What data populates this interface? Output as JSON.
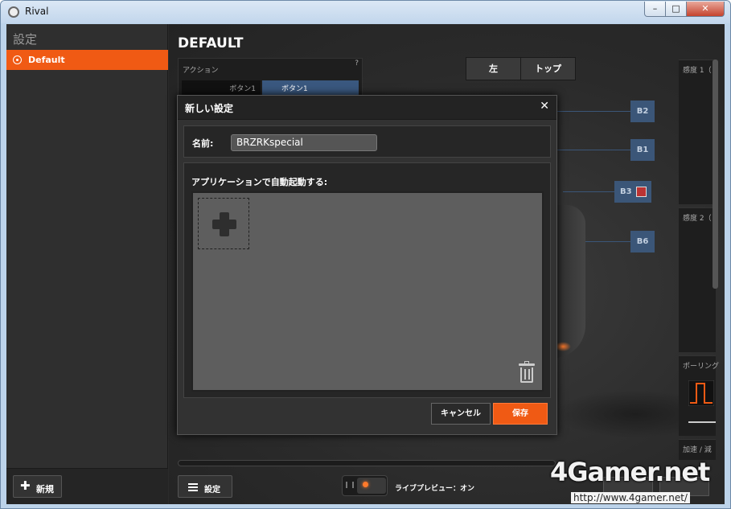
{
  "window": {
    "title": "Rival",
    "min": "–",
    "max": "□",
    "close": "✕"
  },
  "sidebar": {
    "heading": "設定",
    "items": [
      {
        "label": "Default",
        "selected": true
      }
    ],
    "new_button": "新規"
  },
  "main": {
    "heading": "DEFAULT",
    "action_panel": {
      "title": "アクション",
      "help": "?",
      "col1": "ボタン1",
      "col2": "ボタン1"
    },
    "view_tabs": [
      "左",
      "トップ"
    ],
    "buttons": [
      "B2",
      "B1",
      "B3",
      "B6"
    ],
    "right_panel": {
      "sens1": "感度 1（",
      "sens2": "感度 2（",
      "polling": "ポーリング",
      "accel": "加速 / 減"
    },
    "settings_button": "設定",
    "live_preview": "ライブプレビュー：オン",
    "bottom_buttons": [
      "",
      ""
    ]
  },
  "dialog": {
    "title": "新しい設定",
    "close": "✕",
    "name_label": "名前:",
    "name_value": "BRZRKspecial",
    "apps_label": "アプリケーションで自動起動する:",
    "cancel": "キャンセル",
    "save": "保存"
  },
  "watermark": {
    "logo": "4Gamer.net",
    "url": "http://www.4gamer.net/"
  },
  "colors": {
    "accent": "#f05a14",
    "button_blue": "#3b5678",
    "bg": "#2b2b2b"
  }
}
